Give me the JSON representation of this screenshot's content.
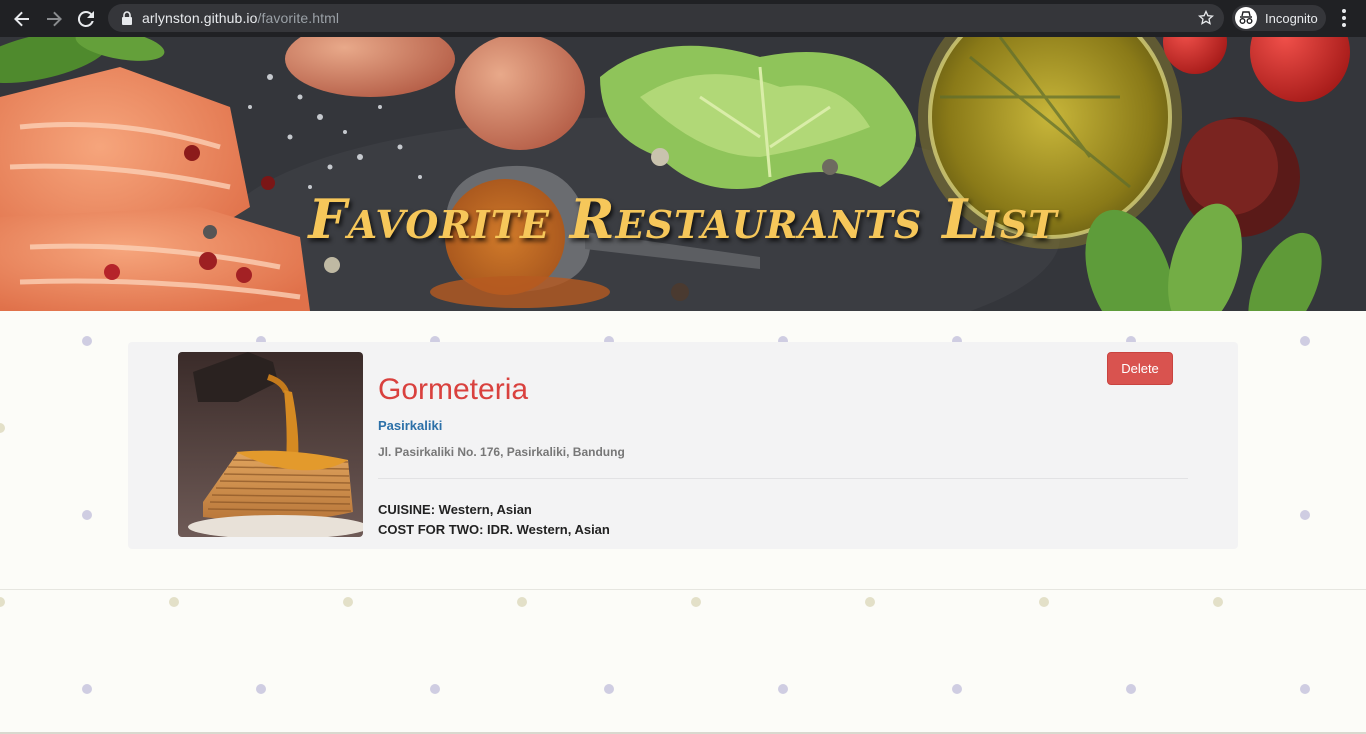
{
  "browser": {
    "url_host": "arlynston.github.io",
    "url_path": "/favorite.html",
    "incognito_label": "Incognito",
    "icons": [
      "back-arrow-icon",
      "forward-arrow-icon",
      "reload-icon",
      "lock-icon",
      "star-icon",
      "incognito-icon",
      "menu-dots-icon"
    ]
  },
  "hero": {
    "title": "Favorite Restaurants List",
    "title_color": "#f6c75a"
  },
  "favorites": [
    {
      "name": "Gormeteria",
      "city": "Pasirkaliki",
      "address": "Jl. Pasirkaliki No. 176, Pasirkaliki, Bandung",
      "cuisine_line": "CUISINE: Western, Asian",
      "cost_line": "COST FOR TWO: IDR. Western, Asian",
      "delete_label": "Delete"
    }
  ],
  "colors": {
    "name": "#d9413e",
    "city": "#2c70a8",
    "delete_button": "#d9534f",
    "card_bg": "#f3f3f4",
    "page_bg": "#fcfcf8"
  }
}
